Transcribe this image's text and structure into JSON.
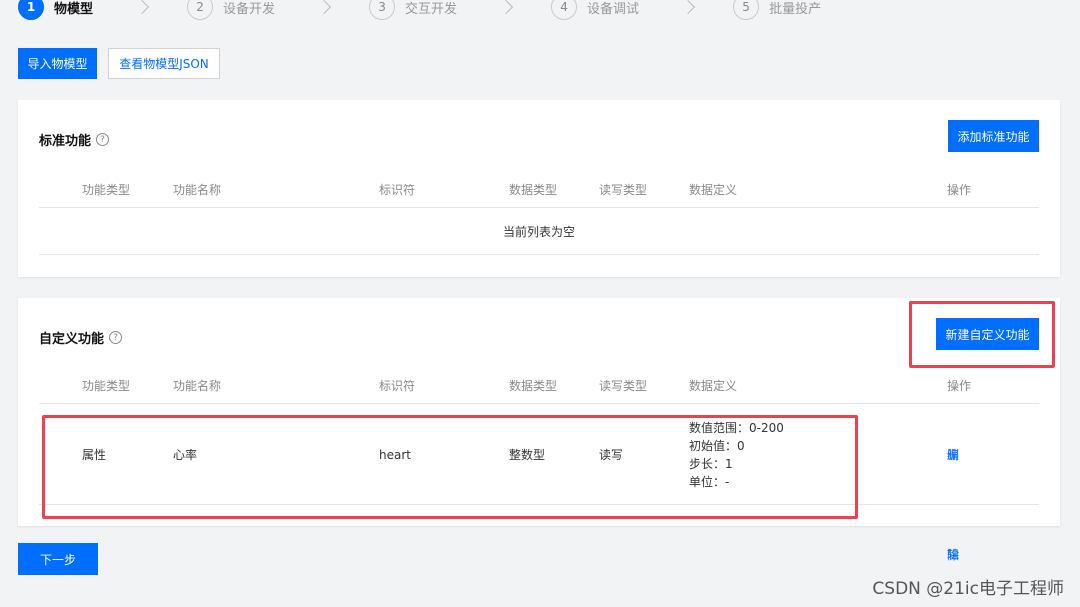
{
  "steps": [
    {
      "num": "1",
      "label": "物模型"
    },
    {
      "num": "2",
      "label": "设备开发"
    },
    {
      "num": "3",
      "label": "交互开发"
    },
    {
      "num": "4",
      "label": "设备调试"
    },
    {
      "num": "5",
      "label": "批量投产"
    }
  ],
  "toolbar": {
    "import_label": "导入物模型",
    "json_label": "查看物模型JSON"
  },
  "columns": [
    "功能类型",
    "功能名称",
    "标识符",
    "数据类型",
    "读写类型",
    "数据定义",
    "操作"
  ],
  "standard": {
    "title": "标准功能",
    "add_label": "添加标准功能",
    "empty_text": "当前列表为空"
  },
  "custom": {
    "title": "自定义功能",
    "new_label": "新建自定义功能",
    "rows": [
      {
        "type": "属性",
        "name": "心率",
        "identifier": "heart",
        "data_type": "整数型",
        "rw": "读写",
        "defs": [
          "数值范围：0-200",
          "初始值：0",
          "步长：1",
          "单位：-"
        ],
        "edit": "编辑",
        "delete": "删除"
      }
    ]
  },
  "next_label": "下一步",
  "watermark": "CSDN @21ic电子工程师",
  "colors": {
    "accent": "#006eff",
    "highlight": "#e8444f"
  }
}
